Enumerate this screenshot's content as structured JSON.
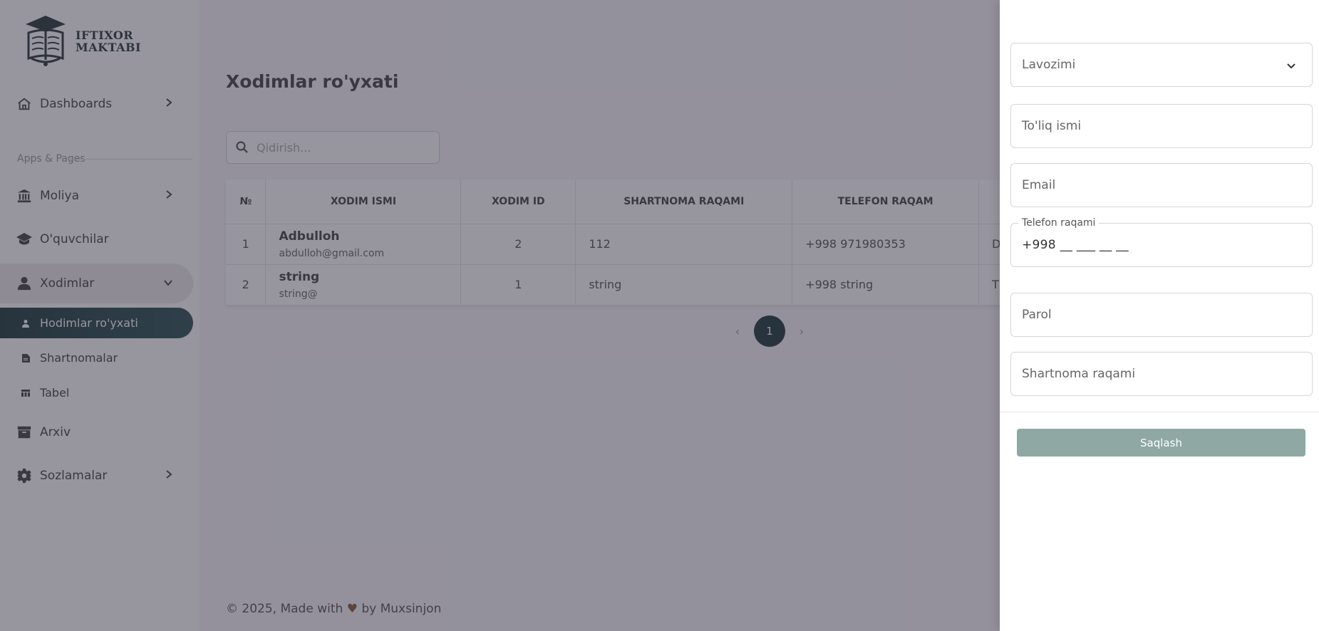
{
  "brand": {
    "line1": "IFTIXOR",
    "line2": "MAKTABI"
  },
  "sidebar": {
    "section_label": "Apps & Pages",
    "items": [
      {
        "label": "Dashboards",
        "icon": "home-icon"
      },
      {
        "label": "Moliya",
        "icon": "bank-icon"
      },
      {
        "label": "O'quvchilar",
        "icon": "graduation-cap-icon"
      },
      {
        "label": "Xodimlar",
        "icon": "user-icon"
      },
      {
        "label": "Arxiv",
        "icon": "archive-icon"
      },
      {
        "label": "Sozlamalar",
        "icon": "gear-icon"
      }
    ],
    "sub_items": [
      {
        "label": "Hodimlar ro'yxati",
        "icon": "person-dot-icon"
      },
      {
        "label": "Shartnomalar",
        "icon": "document-icon"
      },
      {
        "label": "Tabel",
        "icon": "table-icon"
      }
    ]
  },
  "main": {
    "title": "Xodimlar ro'yxati",
    "search": {
      "placeholder": "Qidirish..."
    },
    "table": {
      "headers": [
        "№",
        "XODIM ISMI",
        "XODIM ID",
        "SHARTNOMA RAQAMI",
        "TELEFON RAQAM",
        ""
      ],
      "rows": [
        {
          "num": "1",
          "name": "Adbulloh",
          "email": "abdulloh@gmail.com",
          "id": "2",
          "contract": "112",
          "phone": "+998 971980353",
          "extra": "D"
        },
        {
          "num": "2",
          "name": "string",
          "email": "string@",
          "id": "1",
          "contract": "string",
          "phone": "+998 string",
          "extra": "T"
        }
      ]
    },
    "pagination": {
      "prev": "‹",
      "current": "1",
      "next": "›"
    },
    "footer": {
      "prefix": "© 2025, Made with",
      "heart": "♥",
      "suffix": "by Muxsinjon"
    }
  },
  "drawer": {
    "fields": {
      "position": {
        "placeholder": "Lavozimi"
      },
      "full_name": {
        "placeholder": "To'liq ismi"
      },
      "email": {
        "placeholder": "Email"
      },
      "phone": {
        "label": "Telefon raqami",
        "value": "+998 __ ___ __ __"
      },
      "password": {
        "placeholder": "Parol"
      },
      "contract": {
        "placeholder": "Shartnoma raqami"
      }
    },
    "save_label": "Saqlash"
  },
  "colors": {
    "primary": "#1f3d3f",
    "save_button": "#8fa8a4",
    "backdrop": "#2f2b3d"
  }
}
